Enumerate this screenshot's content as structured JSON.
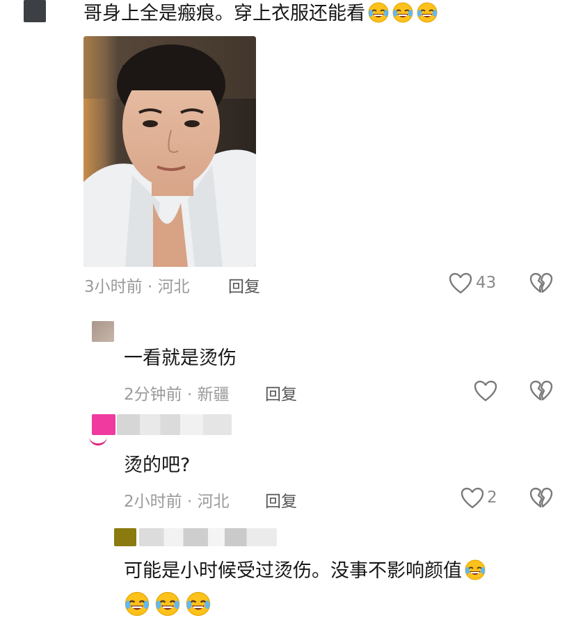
{
  "comment1": {
    "text": "哥身上全是瘢痕。穿上衣服还能看",
    "emoji_count": 3,
    "meta": "3小时前 · 河北",
    "reply": "回复",
    "likes": "43"
  },
  "comment2": {
    "text": "一看就是烫伤",
    "meta": "2分钟前 · 新疆",
    "reply": "回复"
  },
  "comment3": {
    "text": "烫的吧?",
    "meta": "2小时前 · 河北",
    "reply": "回复",
    "likes": "2"
  },
  "comment4": {
    "text": "可能是小时候受过烫伤。没事不影响颜值",
    "emoji_count_line1": 1,
    "emoji_count_line2": 3
  },
  "icons": {
    "like": "heart-outline-icon",
    "dislike": "broken-heart-icon",
    "emoji": "rofl-emoji-icon"
  },
  "colors": {
    "meta_gray": "#9a9a9a",
    "icon_gray": "#7a7a7a",
    "avatar_pink": "#f03aa0",
    "avatar_olive": "#8a7a10"
  }
}
